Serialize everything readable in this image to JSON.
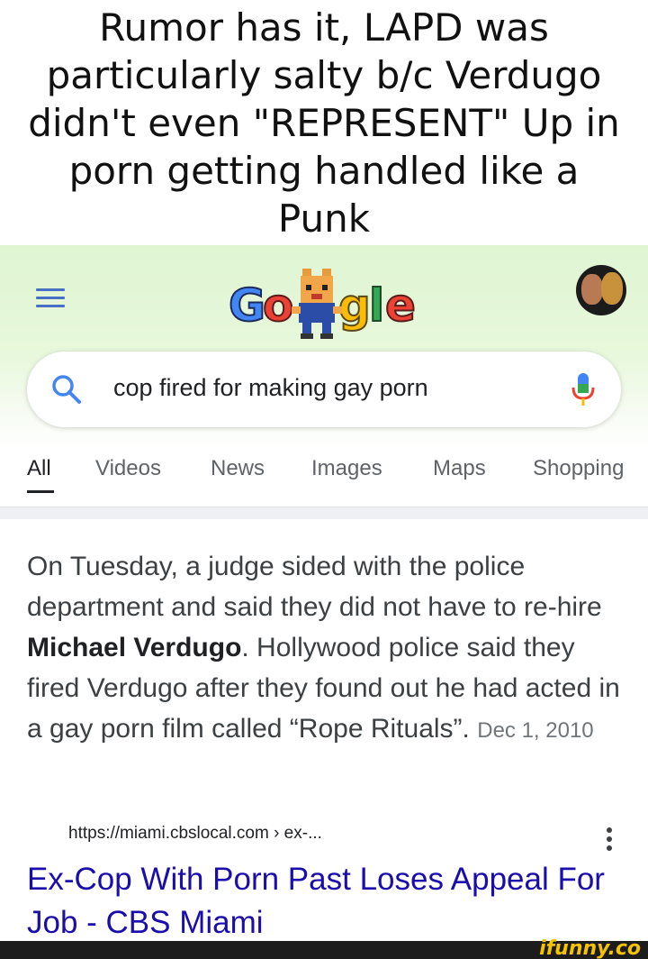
{
  "meme": {
    "caption": "Rumor has it, LAPD was particularly salty b/c Verdugo didn't even \"REPRESENT\" Up in porn getting handled like a Punk"
  },
  "header": {
    "logo_text": "Google",
    "icons": [
      "menu-icon",
      "search-icon",
      "mic-icon",
      "avatar",
      "kebab-icon"
    ],
    "colors": {
      "blue": "#4285f4",
      "red": "#ea4335",
      "yellow": "#fbbc05",
      "green": "#34a853",
      "header_bg": "#dff5d2"
    }
  },
  "search": {
    "query": "cop fired for making gay porn"
  },
  "tabs": [
    {
      "label": "All",
      "active": true
    },
    {
      "label": "Videos",
      "active": false
    },
    {
      "label": "News",
      "active": false
    },
    {
      "label": "Images",
      "active": false
    },
    {
      "label": "Maps",
      "active": false
    },
    {
      "label": "Shopping",
      "active": false
    }
  ],
  "result": {
    "snippet_before": "On Tuesday, a judge sided with the police department and said they did not have to re-hire ",
    "snippet_bold": "Michael Verdugo",
    "snippet_after": ". Hollywood police said they fired Verdugo after they found out he had acted in a gay porn film called “Rope Rituals”.",
    "date": "Dec 1, 2010",
    "url": "https://miami.cbslocal.com › ex-...",
    "title": "Ex-Cop With Porn Past Loses Appeal For Job - CBS Miami"
  },
  "watermark": "ifunny.co"
}
